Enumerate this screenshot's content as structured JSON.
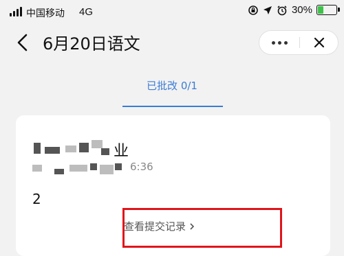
{
  "status_bar": {
    "carrier": "中国移动",
    "network": "4G",
    "battery": "30%",
    "battery_level": 0.3
  },
  "nav": {
    "title": "6月20日语文"
  },
  "tab": {
    "label": "已批改",
    "count": "0/1"
  },
  "card": {
    "title_visible": "业",
    "meta_visible": "6:36",
    "score": "2",
    "view_records": "查看提交记录"
  },
  "colors": {
    "accent": "#3a7bd5",
    "highlight_box": "#e0141a",
    "battery_fill": "#3ec24a"
  }
}
